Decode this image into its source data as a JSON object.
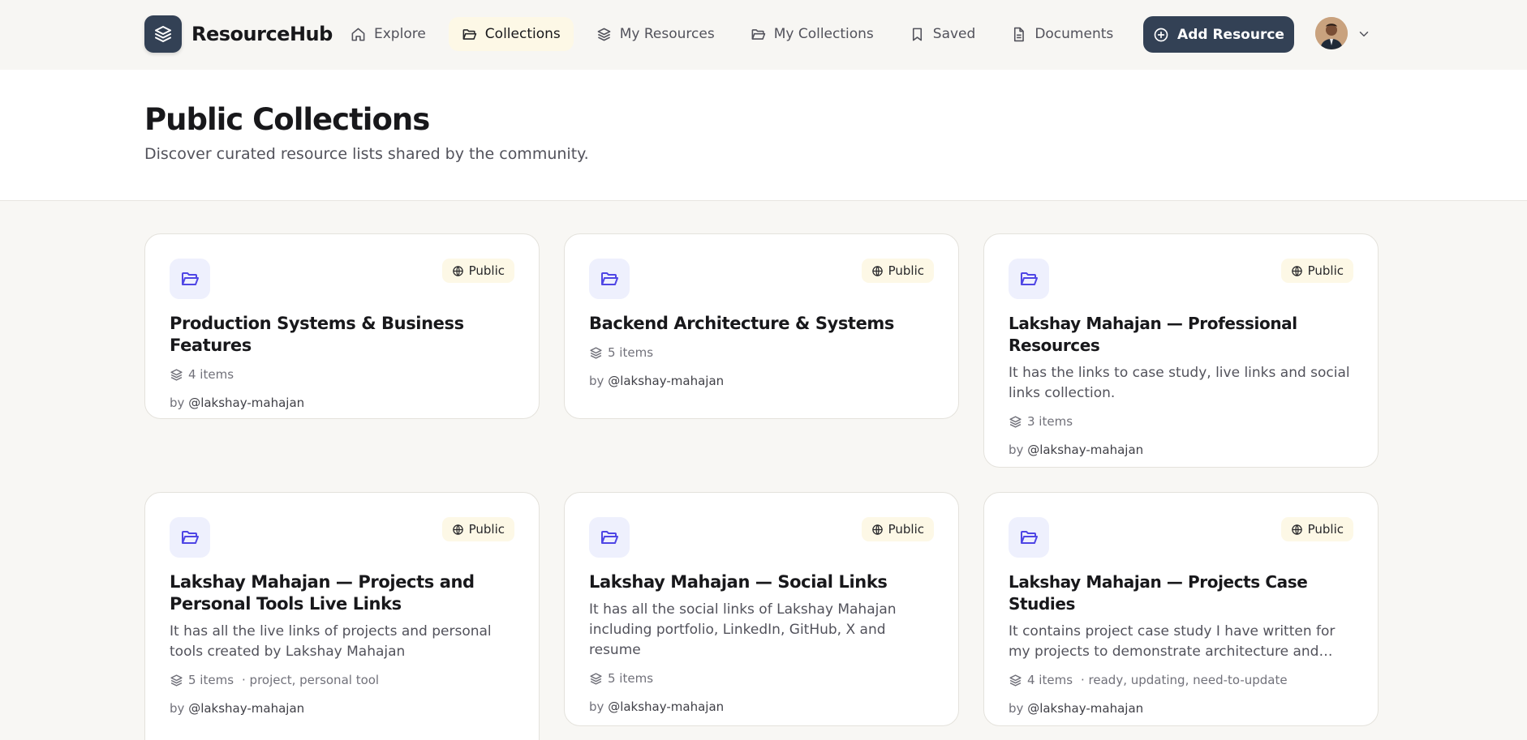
{
  "app": {
    "name": "ResourceHub"
  },
  "nav": {
    "items": [
      {
        "label": "Explore",
        "icon": "home-icon",
        "active": false
      },
      {
        "label": "Collections",
        "icon": "folder-open-icon",
        "active": true
      },
      {
        "label": "My Resources",
        "icon": "layers-icon",
        "active": false
      },
      {
        "label": "My Collections",
        "icon": "folder-icon",
        "active": false
      },
      {
        "label": "Saved",
        "icon": "bookmark-icon",
        "active": false
      },
      {
        "label": "Documents",
        "icon": "document-icon",
        "active": false
      }
    ],
    "add_label": "Add Resource"
  },
  "header": {
    "title": "Public Collections",
    "subtitle": "Discover curated resource lists shared by the community."
  },
  "collections": [
    {
      "title": "Production Systems & Business Features",
      "badge": "Public",
      "description": "",
      "items": "4 items",
      "tags": "",
      "by_prefix": "by",
      "author": "@lakshay-mahajan"
    },
    {
      "title": "Backend Architecture & Systems",
      "badge": "Public",
      "description": "",
      "items": "5 items",
      "tags": "",
      "by_prefix": "by",
      "author": "@lakshay-mahajan"
    },
    {
      "title": "Lakshay Mahajan — Professional Resources",
      "badge": "Public",
      "description": "It has the links to case study, live links and social links collection.",
      "items": "3 items",
      "tags": "",
      "by_prefix": "by",
      "author": "@lakshay-mahajan"
    },
    {
      "title": "Lakshay Mahajan — Projects and Personal Tools Live Links",
      "badge": "Public",
      "description": "It has all the live links of projects and personal tools created by Lakshay Mahajan",
      "items": "5 items",
      "tags": "· project, personal tool",
      "by_prefix": "by",
      "author": "@lakshay-mahajan"
    },
    {
      "title": "Lakshay Mahajan — Social Links",
      "badge": "Public",
      "description": "It has all the social links of Lakshay Mahajan including portfolio, LinkedIn, GitHub, X and resume",
      "items": "5 items",
      "tags": "",
      "by_prefix": "by",
      "author": "@lakshay-mahajan"
    },
    {
      "title": "Lakshay Mahajan — Projects Case Studies",
      "badge": "Public",
      "description": "It contains project case study I have written for my projects to demonstrate architecture and technica...",
      "items": "4 items",
      "tags": "· ready, updating, need-to-update",
      "by_prefix": "by",
      "author": "@lakshay-mahajan"
    }
  ],
  "colors": {
    "primary": "#334155",
    "accent_icon": "#4f46e5",
    "active_nav_bg": "#fdf8e6",
    "page_bg": "#f8f7f4"
  }
}
